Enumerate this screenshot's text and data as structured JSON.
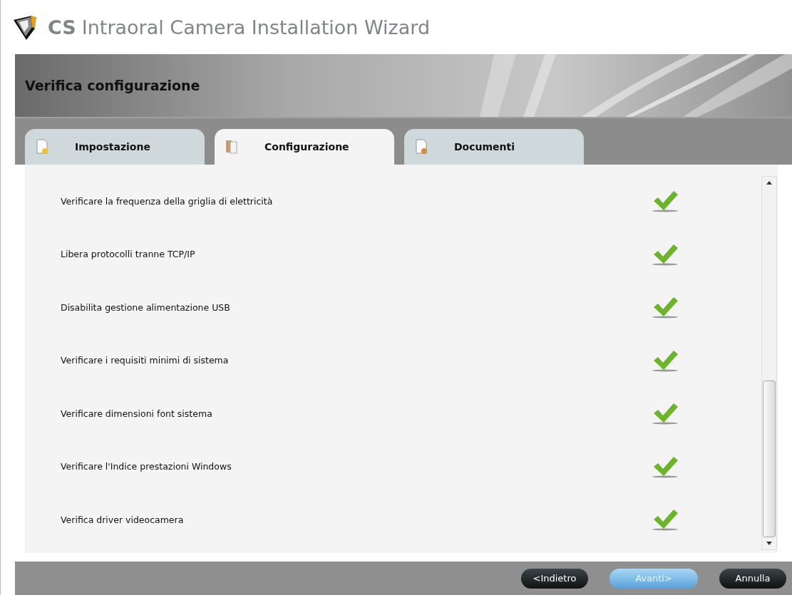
{
  "window": {
    "brand": "CS",
    "title": "Intraoral Camera Installation Wizard"
  },
  "header": {
    "title": "Verifica configurazione"
  },
  "tabs": [
    {
      "label": "Impostazione",
      "selected": false
    },
    {
      "label": "Configurazione",
      "selected": true
    },
    {
      "label": "Documenti",
      "selected": false
    }
  ],
  "checks": [
    {
      "label": "Verificare la frequenza della griglia di elettricità",
      "passed": true
    },
    {
      "label": "Libera protocolli tranne TCP/IP",
      "passed": true
    },
    {
      "label": "Disabilita gestione alimentazione USB",
      "passed": true
    },
    {
      "label": "Verificare i requisiti minimi di sistema",
      "passed": true
    },
    {
      "label": "Verificare dimensioni font sistema",
      "passed": true
    },
    {
      "label": "Verificare l'Indice prestazioni Windows",
      "passed": true
    },
    {
      "label": "Verifica driver videocamera",
      "passed": true
    }
  ],
  "buttons": [
    {
      "label": "<Indietro",
      "kind": "dark"
    },
    {
      "label": "Avanti>",
      "kind": "primary"
    },
    {
      "label": "Annulla",
      "kind": "dark"
    }
  ]
}
